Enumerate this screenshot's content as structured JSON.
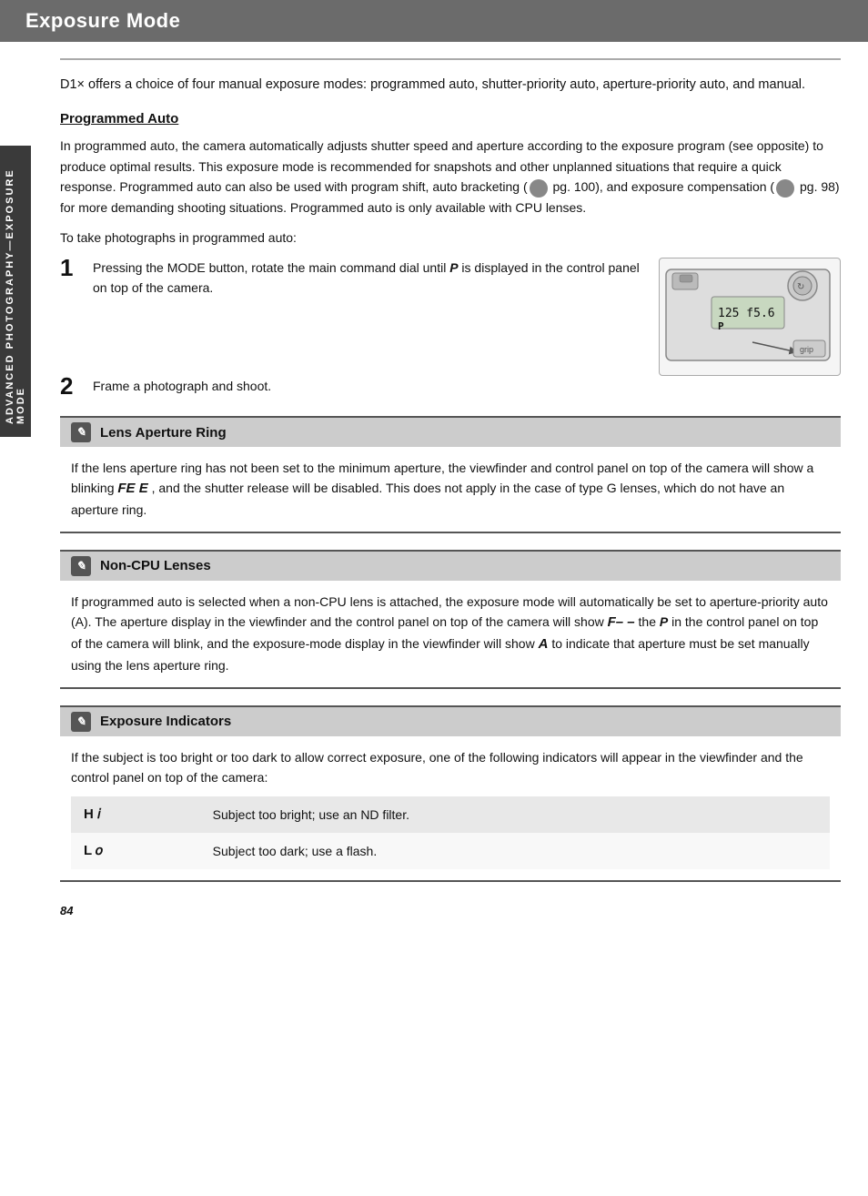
{
  "header": {
    "title": "Exposure Mode",
    "bg_color": "#6b6b6b"
  },
  "side_tab": {
    "label": "ADVANCED PHOTOGRAPHY—EXPOSURE MODE"
  },
  "intro": {
    "text": "D1× offers a choice of four manual exposure modes: programmed auto, shutter-priority auto, aperture-priority auto, and manual."
  },
  "programmed_auto": {
    "heading": "Programmed Auto",
    "body1": "In programmed auto, the camera automatically adjusts shutter speed and aperture according to the exposure program (see opposite) to produce optimal results. This exposure mode is recommended for snapshots and other unplanned situations that require a quick response.  Programmed auto can also be used with program shift, auto bracketing (  pg. 100), and exposure compensation (  pg. 98) for more demanding shooting situations.  Programmed auto is only available with CPU lenses.",
    "sub": "To take photographs in programmed auto:",
    "step1_text": "Pressing the MODE button, rotate the main command dial until ",
    "step1_bold": "P",
    "step1_text2": " is displayed in the control panel on top of the camera.",
    "step2": "Frame a photograph and shoot."
  },
  "lens_aperture": {
    "title": "Lens Aperture Ring",
    "icon": "pencil-icon",
    "body": "If the lens aperture ring has not been set to the minimum aperture, the viewfinder and control panel on top of the camera will show a blinking FE E , and the shutter release will be disabled. This does not apply in the case of type G lenses, which do not have an aperture ring."
  },
  "non_cpu": {
    "title": "Non-CPU Lenses",
    "icon": "pencil-icon",
    "body": "If programmed auto is selected when a non-CPU lens is attached, the exposure mode will automatically be set to aperture-priority auto (A).  The aperture display in the viewfinder and the control panel on top of the camera will show F–  – the P in the control panel on top of the camera will blink, and the exposure-mode display in the viewfinder will show  A  to indicate that aperture must be set manually using the lens aperture ring."
  },
  "exposure_indicators": {
    "title": "Exposure Indicators",
    "icon": "pencil-icon",
    "body": "If the subject is too bright or too dark to allow correct exposure, one of the following indicators will appear in the viewfinder and the control panel on top of the camera:",
    "rows": [
      {
        "symbol": "H i",
        "description": "Subject too bright; use an ND filter."
      },
      {
        "symbol": "L o",
        "description": "Subject too dark; use a flash."
      }
    ]
  },
  "page_number": "84"
}
